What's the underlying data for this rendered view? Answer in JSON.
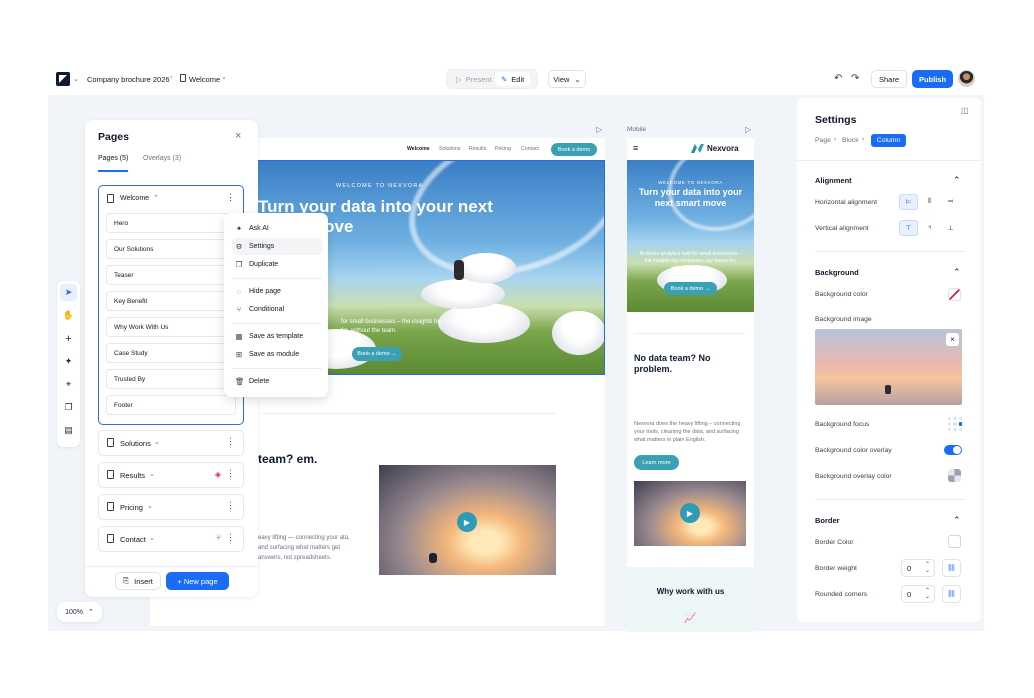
{
  "topbar": {
    "project": "Company brochure 2026",
    "page": "Welcome",
    "present_label": "Present",
    "edit_label": "Edit",
    "view_label": "View",
    "share_label": "Share",
    "publish_label": "Publish"
  },
  "pages_panel": {
    "title": "Pages",
    "tabs": [
      "Pages (5)",
      "Overlays (3)"
    ],
    "pages": [
      {
        "label": "Welcome",
        "sections": [
          "Hero",
          "Our Solutions",
          "Teaser",
          "Key Benefit",
          "Why Work With Us",
          "Case Study",
          "Trusted By",
          "Footer"
        ]
      },
      {
        "label": "Solutions"
      },
      {
        "label": "Results"
      },
      {
        "label": "Pricing"
      },
      {
        "label": "Contact"
      }
    ],
    "insert_label": "Insert",
    "new_page_label": "+ New page"
  },
  "context_menu": {
    "items": [
      "Ask AI",
      "Settings",
      "Duplicate",
      "Hide page",
      "Conditional",
      "Save as template",
      "Save as module",
      "Delete"
    ]
  },
  "zoom": "100%",
  "desktop": {
    "nav": [
      "Welcome",
      "Solutions",
      "Results",
      "Pricing",
      "Contact"
    ],
    "nav_cta": "Book a demo",
    "eyebrow": "WELCOME TO NEXVORA",
    "headline": "Turn your data into your next smart move",
    "sub": "for small businesses – the insights big companies pay teams for, without the team.",
    "cta": "Book a demo →",
    "section_title": "team? em.",
    "section_body": "eavy lifting — connecting your ata, and surfacing what matters get answers, not spreadsheets."
  },
  "mobile": {
    "label": "Mobile",
    "brand": "Nexvora",
    "eyebrow": "WELCOME TO NEXVORA",
    "headline": "Turn your data into your next smart move",
    "sub": "AI-driven analytics built for small businesses – the insights big companies pay teams for, without the team.",
    "cta": "Book a demo →",
    "section_title": "No data team? No problem.",
    "section_body": "Nexvora does the heavy lifting – connecting your tools, cleaning the data, and surfacing what matters in plain English.",
    "learn_more": "Learn more",
    "why_title": "Why work with us"
  },
  "settings": {
    "title": "Settings",
    "breadcrumb": [
      "Page",
      "Block",
      "Column"
    ],
    "alignment": {
      "title": "Alignment",
      "horizontal": "Horizontal alignment",
      "vertical": "Vertical alignment"
    },
    "background": {
      "title": "Background",
      "color": "Background color",
      "image": "Background image",
      "focus": "Background focus",
      "overlay": "Background color overlay",
      "overlay_color": "Background overlay color"
    },
    "border": {
      "title": "Border",
      "color": "Border Color",
      "weight": "Border weight",
      "weight_value": "0",
      "corners": "Rounded corners",
      "corners_value": "0"
    },
    "colors": {
      "accent": "#1a6cf5",
      "teal": "#3aa1b5"
    }
  }
}
